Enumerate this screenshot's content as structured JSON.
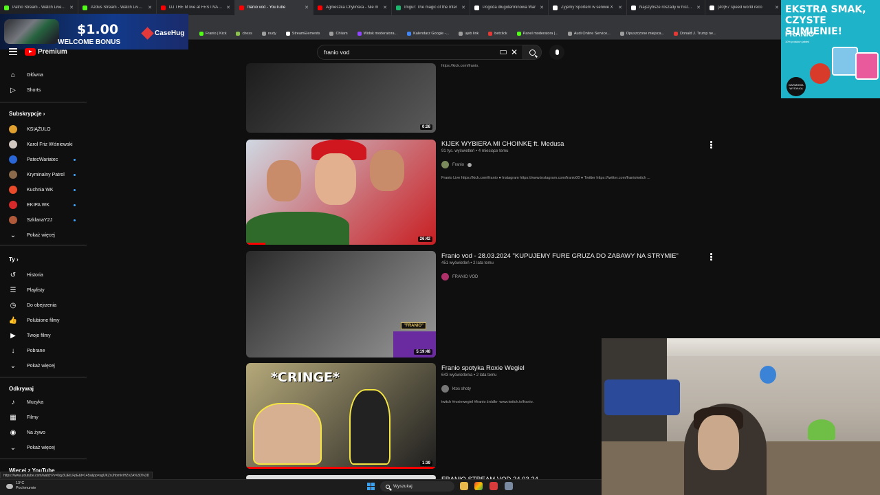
{
  "browser": {
    "tabs": [
      {
        "title": "Patrio Stream - Watch Live on",
        "color": "#53fc18",
        "active": false
      },
      {
        "title": "Azdus Stream - Watch Live on",
        "color": "#53fc18",
        "active": false
      },
      {
        "title": "DJ THE M live at FESTIVALAN",
        "color": "#ff0000",
        "active": false
      },
      {
        "title": "franio vod - YouTube",
        "color": "#ff0000",
        "active": true
      },
      {
        "title": "Agnieszka Chylińska - Nie m",
        "color": "#ff0000",
        "active": false
      },
      {
        "title": "Imgur: The magic of the Inter",
        "color": "#1bb76e",
        "active": false
      },
      {
        "title": "Pogoda długoterminowa War",
        "color": "#ffffff",
        "active": false
      },
      {
        "title": "Żyjemy Sportem w senwie X",
        "color": "#ffffff",
        "active": false
      },
      {
        "title": "Najszybsze roszady w historii",
        "color": "#ffffff",
        "active": false
      },
      {
        "title": "(40)67 speed world reco",
        "color": "#ffffff",
        "active": false
      }
    ],
    "bookmarks": [
      {
        "label": "Franio | Kick",
        "color": "#53fc18"
      },
      {
        "label": "chess",
        "color": "#8bc34a"
      },
      {
        "label": "nudy",
        "color": "#9e9e9e"
      },
      {
        "label": "StreamElements",
        "color": "#ffffff"
      },
      {
        "label": "Chilam",
        "color": "#9e9e9e"
      },
      {
        "label": "Widok moderatora...",
        "color": "#9146ff"
      },
      {
        "label": "Kalendarz Google -...",
        "color": "#4285f4"
      },
      {
        "label": "ujeb link",
        "color": "#9e9e9e"
      },
      {
        "label": "betclick",
        "color": "#e53935"
      },
      {
        "label": "Panel moderatora |...",
        "color": "#53fc18"
      },
      {
        "label": "Audi Online Service...",
        "color": "#9e9e9e"
      },
      {
        "label": "Opuszczone miejsca...",
        "color": "#9e9e9e"
      },
      {
        "label": "Donald J. Trump ne...",
        "color": "#e53935"
      }
    ]
  },
  "ads": {
    "left": {
      "amount": "$1.00",
      "bonus": "WELCOME BONUS",
      "brand": "CaseHug"
    },
    "right": {
      "headline": "EKSTRA SMAK, CZYSTE SUMIENIE!",
      "logo": "FRANIO",
      "sub": "10% polskich jabłek",
      "badge": "DARMOWA WYSYŁKA"
    }
  },
  "youtube": {
    "logo_text": "Premium",
    "search_value": "franio vod",
    "sidebar": {
      "main": [
        {
          "label": "Główna",
          "icon": "home-icon"
        },
        {
          "label": "Shorts",
          "icon": "shorts-icon"
        }
      ],
      "subscriptions_header": "Subskrypcje",
      "subscriptions": [
        {
          "label": "KSIĄŻULO",
          "color": "#e0a030",
          "live": false
        },
        {
          "label": "Karol Friz Wiśniewski",
          "color": "#cfc7c0",
          "live": false
        },
        {
          "label": "PatecWariatec",
          "color": "#2a66d6",
          "live": true
        },
        {
          "label": "Kryminalny Patrol",
          "color": "#8a6a4a",
          "live": true
        },
        {
          "label": "Kuchnia WK",
          "color": "#e84a2a",
          "live": true
        },
        {
          "label": "EKIPA WK",
          "color": "#d62a2a",
          "live": true
        },
        {
          "label": "SzklanaY2J",
          "color": "#b05a3a",
          "live": true
        }
      ],
      "show_more_1": "Pokaż więcej",
      "you_header": "Ty",
      "you": [
        {
          "label": "Historia",
          "icon": "history-icon"
        },
        {
          "label": "Playlisty",
          "icon": "playlist-icon"
        },
        {
          "label": "Do obejrzenia",
          "icon": "watch-later-icon"
        },
        {
          "label": "Polubione filmy",
          "icon": "like-icon"
        },
        {
          "label": "Twoje filmy",
          "icon": "your-videos-icon"
        },
        {
          "label": "Pobrane",
          "icon": "download-icon"
        }
      ],
      "show_more_2": "Pokaż więcej",
      "explore_header": "Odkrywaj",
      "explore": [
        {
          "label": "Muzyka",
          "icon": "music-icon"
        },
        {
          "label": "Filmy",
          "icon": "film-icon"
        },
        {
          "label": "Na żywo",
          "icon": "live-icon"
        }
      ],
      "show_more_3": "Pokaż więcej",
      "more_from": "Więcej z YouTube"
    },
    "results": [
      {
        "title": "",
        "meta": "",
        "channel": "",
        "desc": "https://kick.com/franio.",
        "duration": "0:26",
        "thumb_colors": [
          "#1c1c1c",
          "#5a5a5a"
        ],
        "progress": 0
      },
      {
        "title": "KIJEK WYBIERA MI CHOINKĘ ft. Medusa",
        "meta": "91 tys. wyświetleń • 4 miesiące temu",
        "channel": "Franio",
        "desc": "Franio Live https://kick.com/franio ● Instagram https://www.instagram.com/franio00 ● Twitter https://twitter.com/franiotwitch ...",
        "duration": "26:42",
        "thumb_colors": [
          "#cfd8e2",
          "#c81e22"
        ],
        "progress": 0.1
      },
      {
        "title": "Franio vod - 28.03.2024 \"KUPUJEMY FURE GRUZA DO ZABAWY NA STRYMIE\"",
        "meta": "451 wyświetleń • 2 lata temu",
        "channel": "FRANIO VOD",
        "desc": "",
        "duration": "5:19:48",
        "thumb_colors": [
          "#2a2a2a",
          "#9a9a9a"
        ],
        "progress": 0
      },
      {
        "title": "Franio spotyka Roxie Wegiel",
        "meta": "643 wyświetlenia • 2 lata temu",
        "channel": "ktos shoty",
        "desc": "twitch #roxiewegiel #franio źródło- www.twitch.tv/franio.",
        "duration": "1:39",
        "thumb_colors": [
          "#b5a97a",
          "#1e1e1e"
        ],
        "progress": 1
      }
    ],
    "partial_next_title": "FRANIO STREAM VOD 24.03.24"
  },
  "status_url": "https://www.youtube.com/watch?v=0qy3UEtLFpE&t=145s&pp=ygUKZnJhbmlvIHZvZA%3D%3D",
  "taskbar": {
    "temp": "13°C",
    "weather": "Pochmurnie",
    "search": "Wyszukaj"
  },
  "thumb_overlays": {
    "cringe": "*CRINGE*",
    "franio_tag": "\"FRANIO\""
  }
}
